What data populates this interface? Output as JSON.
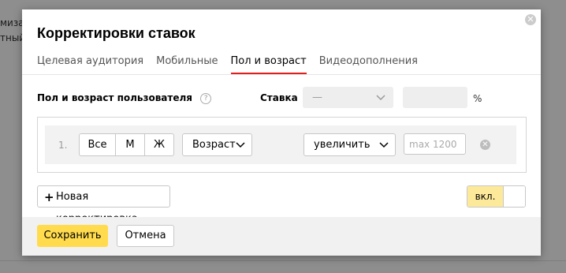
{
  "background": {
    "text_line1": "миза",
    "text_line2": "тный"
  },
  "dialog": {
    "title": "Корректировки ставок",
    "close_icon": "close-icon",
    "tabs": [
      {
        "label": "Целевая аудитория",
        "active": false
      },
      {
        "label": "Мобильные",
        "active": false
      },
      {
        "label": "Пол и возраст",
        "active": true
      },
      {
        "label": "Видеодополнения",
        "active": false
      }
    ],
    "section_label": "Пол и возраст пользователя",
    "help_icon": "?",
    "stavka": {
      "label": "Ставка",
      "selected": "—",
      "percent": "%"
    },
    "rule": {
      "number": "1.",
      "gender": [
        "Все",
        "М",
        "Ж"
      ],
      "age_button": "Возраст",
      "action": "увеличить",
      "max_placeholder": "max 1200",
      "remove_icon": "close-icon"
    },
    "add_button": {
      "plus": "+",
      "label": "Новая корректировка"
    },
    "toggle": {
      "label": "вкл.",
      "state": "on",
      "accent_color": "#fde99a"
    },
    "footer": {
      "save_label": "Сохранить",
      "cancel_label": "Отмена",
      "save_color": "#ffdb4d"
    }
  },
  "colors": {
    "active_tab_underline": "#e11d1d"
  }
}
